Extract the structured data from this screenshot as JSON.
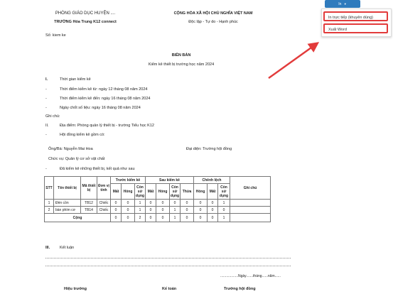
{
  "header": {
    "dept": "PHÒNG GIÁO DỤC HUYỆN ....",
    "school": "TRƯỜNG Hóa Trung K12 connect",
    "republic": "CỘNG HÒA XÃ HỘI CHỦ NGHĨA VIỆT NAM",
    "motto": "Độc lập - Tự do - Hạnh phúc",
    "number": "Số: kiem ke"
  },
  "title": {
    "main": "BIÊN BẢN",
    "sub": "Kiểm kê thiết bị trường học năm 2024"
  },
  "sections": {
    "s1_num": "I.",
    "s1": "Thời gian kiểm kê",
    "s1_a": "Thời điểm kiểm kê từ: ngày 12 tháng 08 năm 2024",
    "s1_b": "Thời điểm kiểm kê đến: ngày 16 tháng 08 năm 2024",
    "s1_c": "Ngày chốt số liệu: ngày 16 tháng 08 năm 2024",
    "note": "Ghi chú:",
    "s2_num": "II.",
    "s2": "Địa điểm: Phòng quản lý thiết bị - trường Tiểu học K12",
    "s2_a": "Hội đồng kiểm kê gồm có:",
    "person": "Ông/Bà: Nguyễn Mai Hoa",
    "rep": "Đại diện: Trường hội đồng",
    "role": "Chức vụ: Quản lý cơ sở vật chất",
    "s2_b": "Đã kiểm kê những thiết bị, kết quả như sau",
    "s3_num": "III.",
    "s3": "Kết luận",
    "dash": "-"
  },
  "table": {
    "h_stt": "STT",
    "h_name": "Tên thiết bị",
    "h_code": "Mã thiết bị",
    "h_unit": "Đơn vị tính",
    "h_before": "Trước kiểm kê",
    "h_after": "Sau kiểm kê",
    "h_diff": "Chênh lệch",
    "h_note": "Ghi chú",
    "h_lost": "Mất",
    "h_broken": "Hỏng",
    "h_usable": "Còn sử dụng",
    "h_extra": "Thừa",
    "rows": [
      [
        "1",
        "Đèn cồn",
        "TB12",
        "Chiếc",
        "0",
        "0",
        "1",
        "0",
        "0",
        "0",
        "0",
        "0",
        "0",
        "1",
        ""
      ],
      [
        "2",
        "bàn phím cơ",
        "TB14",
        "Chiếc",
        "0",
        "0",
        "1",
        "0",
        "0",
        "1",
        "0",
        "0",
        "0",
        "0",
        ""
      ]
    ],
    "total": [
      "Cộng",
      "0",
      "0",
      "2",
      "0",
      "0",
      "1",
      "0",
      "0",
      "0",
      "1",
      ""
    ]
  },
  "date_line": "..................Ngày.......tháng......năm......",
  "signatures": {
    "principal": "Hiệu trưởng",
    "accountant": "Kế toán",
    "chair": "Trưởng hội đồng"
  },
  "print_menu": {
    "button": "In",
    "items": [
      "In trực tiếp (khuyên dùng)",
      "Xuất Word"
    ]
  },
  "colors": {
    "button": "#2f7bbd",
    "highlight": "#e23b3b"
  }
}
